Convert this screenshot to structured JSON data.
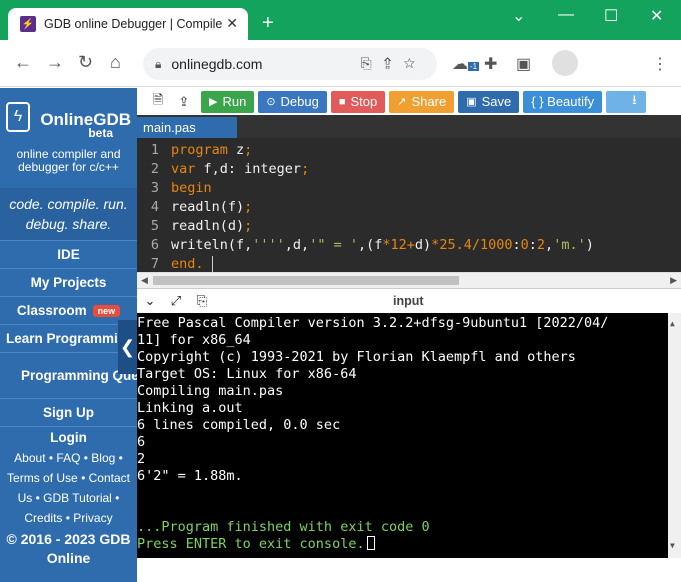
{
  "browser": {
    "tab_title": "GDB online Debugger | Compile",
    "url": "onlinegdb.com",
    "ext_badge": "-1"
  },
  "sidebar": {
    "brand": "OnlineGDB",
    "beta": "beta",
    "tagline": "online compiler and debugger for c/c++",
    "motto": "code. compile. run. debug. share.",
    "items": [
      {
        "label": "IDE"
      },
      {
        "label": "My Projects"
      },
      {
        "label": "Classroom",
        "badge": "new"
      },
      {
        "label": "Learn Programming"
      },
      {
        "label": "Programming Questions"
      },
      {
        "label": "Sign Up"
      },
      {
        "label": "Login"
      }
    ],
    "footer_links": "About • FAQ • Blog • Terms of Use • Contact Us • GDB Tutorial • Credits • Privacy",
    "copyright": "© 2016 - 2023 GDB Online"
  },
  "toolbar": {
    "run": "Run",
    "debug": "Debug",
    "stop": "Stop",
    "share": "Share",
    "save": "Save",
    "beautify": "{ } Beautify"
  },
  "colors": {
    "run": "#3aa54a",
    "debug": "#3b76c1",
    "stop": "#e25b5b",
    "share": "#f0a030",
    "save": "#2f6cae",
    "beautify": "#3b8fd8",
    "download": "#6fb2e8"
  },
  "editor": {
    "file_tab": "main.pas",
    "lines": [
      {
        "n": "1",
        "text": "program z;"
      },
      {
        "n": "2",
        "text": "var f,d: integer;"
      },
      {
        "n": "3",
        "text": "begin"
      },
      {
        "n": "4",
        "text": "readln(f);"
      },
      {
        "n": "5",
        "text": "readln(d);"
      },
      {
        "n": "6",
        "text": "writeln(f,'''',d,'\" = ',(f*12+d)*25.4/1000:0:2,'m.')"
      },
      {
        "n": "7",
        "text": "end."
      }
    ]
  },
  "console": {
    "label": "input",
    "lines": [
      "Free Pascal Compiler version 3.2.2+dfsg-9ubuntu1 [2022/04/",
      "11] for x86_64",
      "Copyright (c) 1993-2021 by Florian Klaempfl and others",
      "Target OS: Linux for x86-64",
      "Compiling main.pas",
      "Linking a.out",
      "6 lines compiled, 0.0 sec",
      "6",
      "2",
      "6'2\" = 1.88m.",
      ""
    ],
    "status_lines": [
      "...Program finished with exit code 0",
      "Press ENTER to exit console."
    ]
  }
}
